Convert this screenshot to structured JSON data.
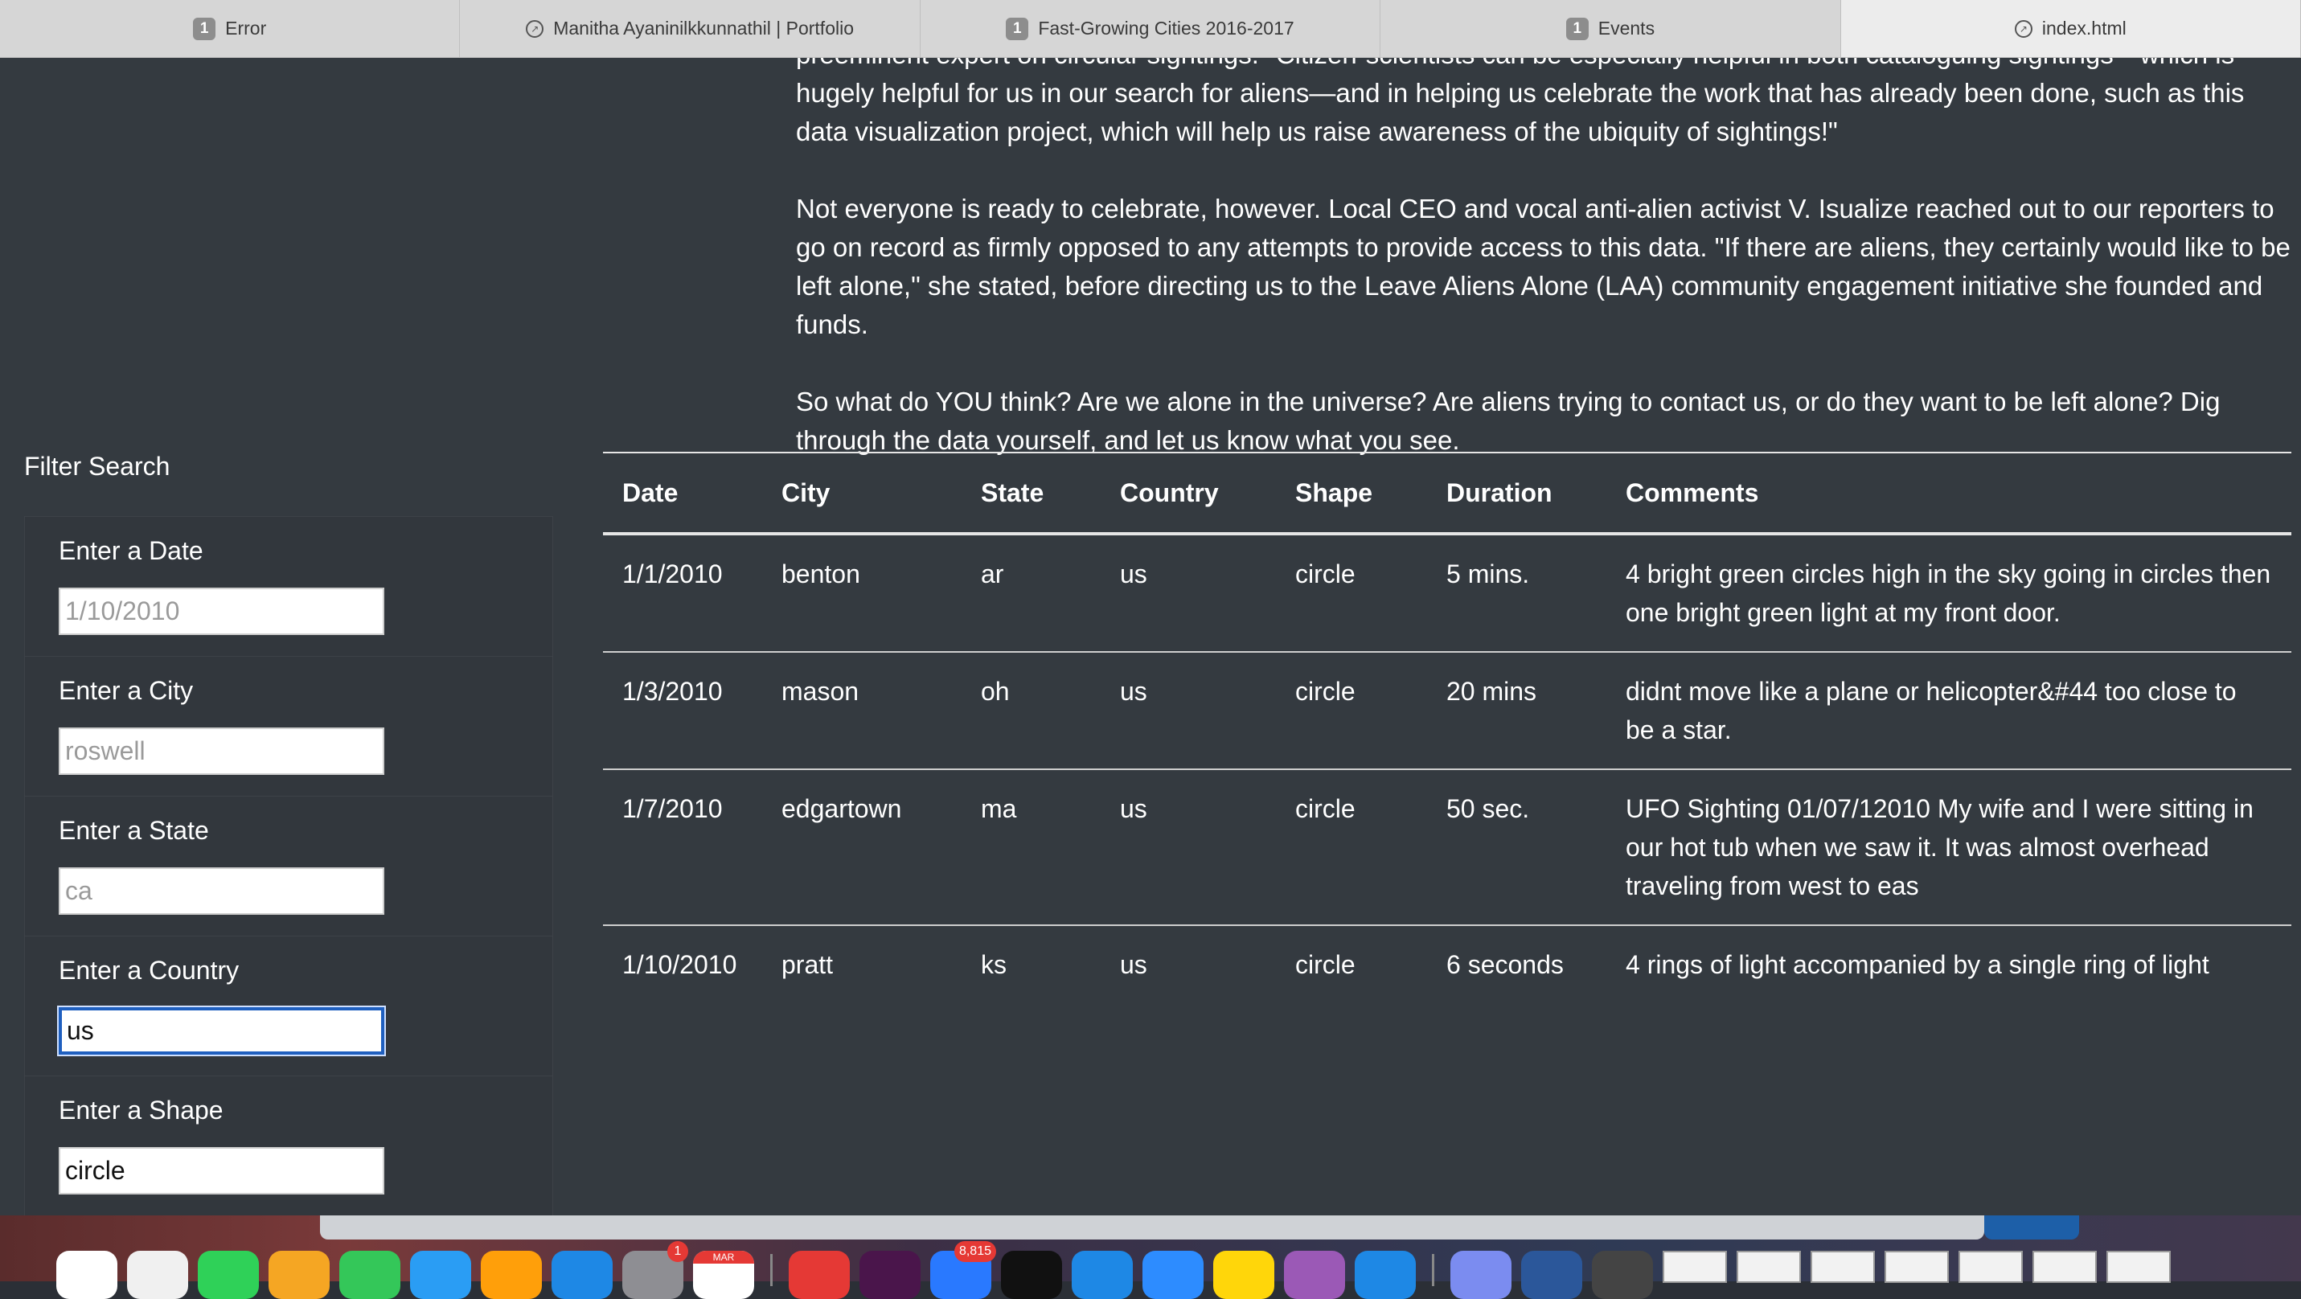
{
  "tabs": [
    {
      "label": "Error",
      "badge": "1",
      "active": false
    },
    {
      "label": "Manitha Ayaninilkkunnathil | Portfolio",
      "badge": "",
      "active": false
    },
    {
      "label": "Fast-Growing Cities 2016-2017",
      "badge": "1",
      "active": false
    },
    {
      "label": "Events",
      "badge": "1",
      "active": false
    },
    {
      "label": "index.html",
      "badge": "",
      "active": true
    }
  ],
  "article": {
    "paragraphs": [
      "preeminent expert on circular sightings. \"Citizen-scientists can be especially helpful in both cataloguing sightings—which is hugely helpful for us in our search for aliens—and in helping us celebrate the work that has already been done, such as this data visualization project, which will help us raise awareness of the ubiquity of sightings!\"",
      "Not everyone is ready to celebrate, however. Local CEO and vocal anti-alien activist V. Isualize reached out to our reporters to go on record as firmly opposed to any attempts to provide access to this data. \"If there are aliens, they certainly would like to be left alone,\" she stated, before directing us to the Leave Aliens Alone (LAA) community engagement initiative she founded and funds.",
      "So what do YOU think? Are we alone in the universe? Are aliens trying to contact us, or do they want to be left alone? Dig through the data yourself, and let us know what you see."
    ]
  },
  "filter": {
    "title": "Filter Search",
    "fields": [
      {
        "label": "Enter a Date",
        "value": "",
        "placeholder": "1/10/2010"
      },
      {
        "label": "Enter a City",
        "value": "",
        "placeholder": "roswell"
      },
      {
        "label": "Enter a State",
        "value": "",
        "placeholder": "ca"
      },
      {
        "label": "Enter a Country",
        "value": "us",
        "placeholder": ""
      },
      {
        "label": "Enter a Shape",
        "value": "circle",
        "placeholder": ""
      }
    ]
  },
  "table": {
    "headers": [
      "Date",
      "City",
      "State",
      "Country",
      "Shape",
      "Duration",
      "Comments"
    ],
    "rows": [
      [
        "1/1/2010",
        "benton",
        "ar",
        "us",
        "circle",
        "5 mins.",
        "4 bright green circles high in the sky going in circles then one bright green light at my front door."
      ],
      [
        "1/3/2010",
        "mason",
        "oh",
        "us",
        "circle",
        "20 mins",
        "didnt move like a plane or helicopter&#44 too close to be a star."
      ],
      [
        "1/7/2010",
        "edgartown",
        "ma",
        "us",
        "circle",
        "50 sec.",
        "UFO Sighting 01/07/12010 My wife and I were sitting in our hot tub when we saw it. It was almost overhead traveling from west to eas"
      ],
      [
        "1/10/2010",
        "pratt",
        "ks",
        "us",
        "circle",
        "6 seconds",
        "4 rings of light accompanied by a single ring of light"
      ]
    ]
  },
  "dock": {
    "calendar_month": "MAR",
    "settings_badge": "1",
    "mail_badge": "8,815",
    "colors": [
      "#ffffff",
      "#f0f0f0",
      "#2fd158",
      "#f5a623",
      "#34c759",
      "#2a9df4",
      "#ff9f0a",
      "#1e88e5",
      "#8e8e93",
      "#ffffff",
      "#e53935",
      "#4a154b",
      "#2979ff",
      "#111111",
      "#1e88e5",
      "#2d8cff",
      "#ffd60a",
      "#9b59b6",
      "#1e88e5",
      "#7b8cf0",
      "#2b579a",
      "#444444"
    ]
  }
}
